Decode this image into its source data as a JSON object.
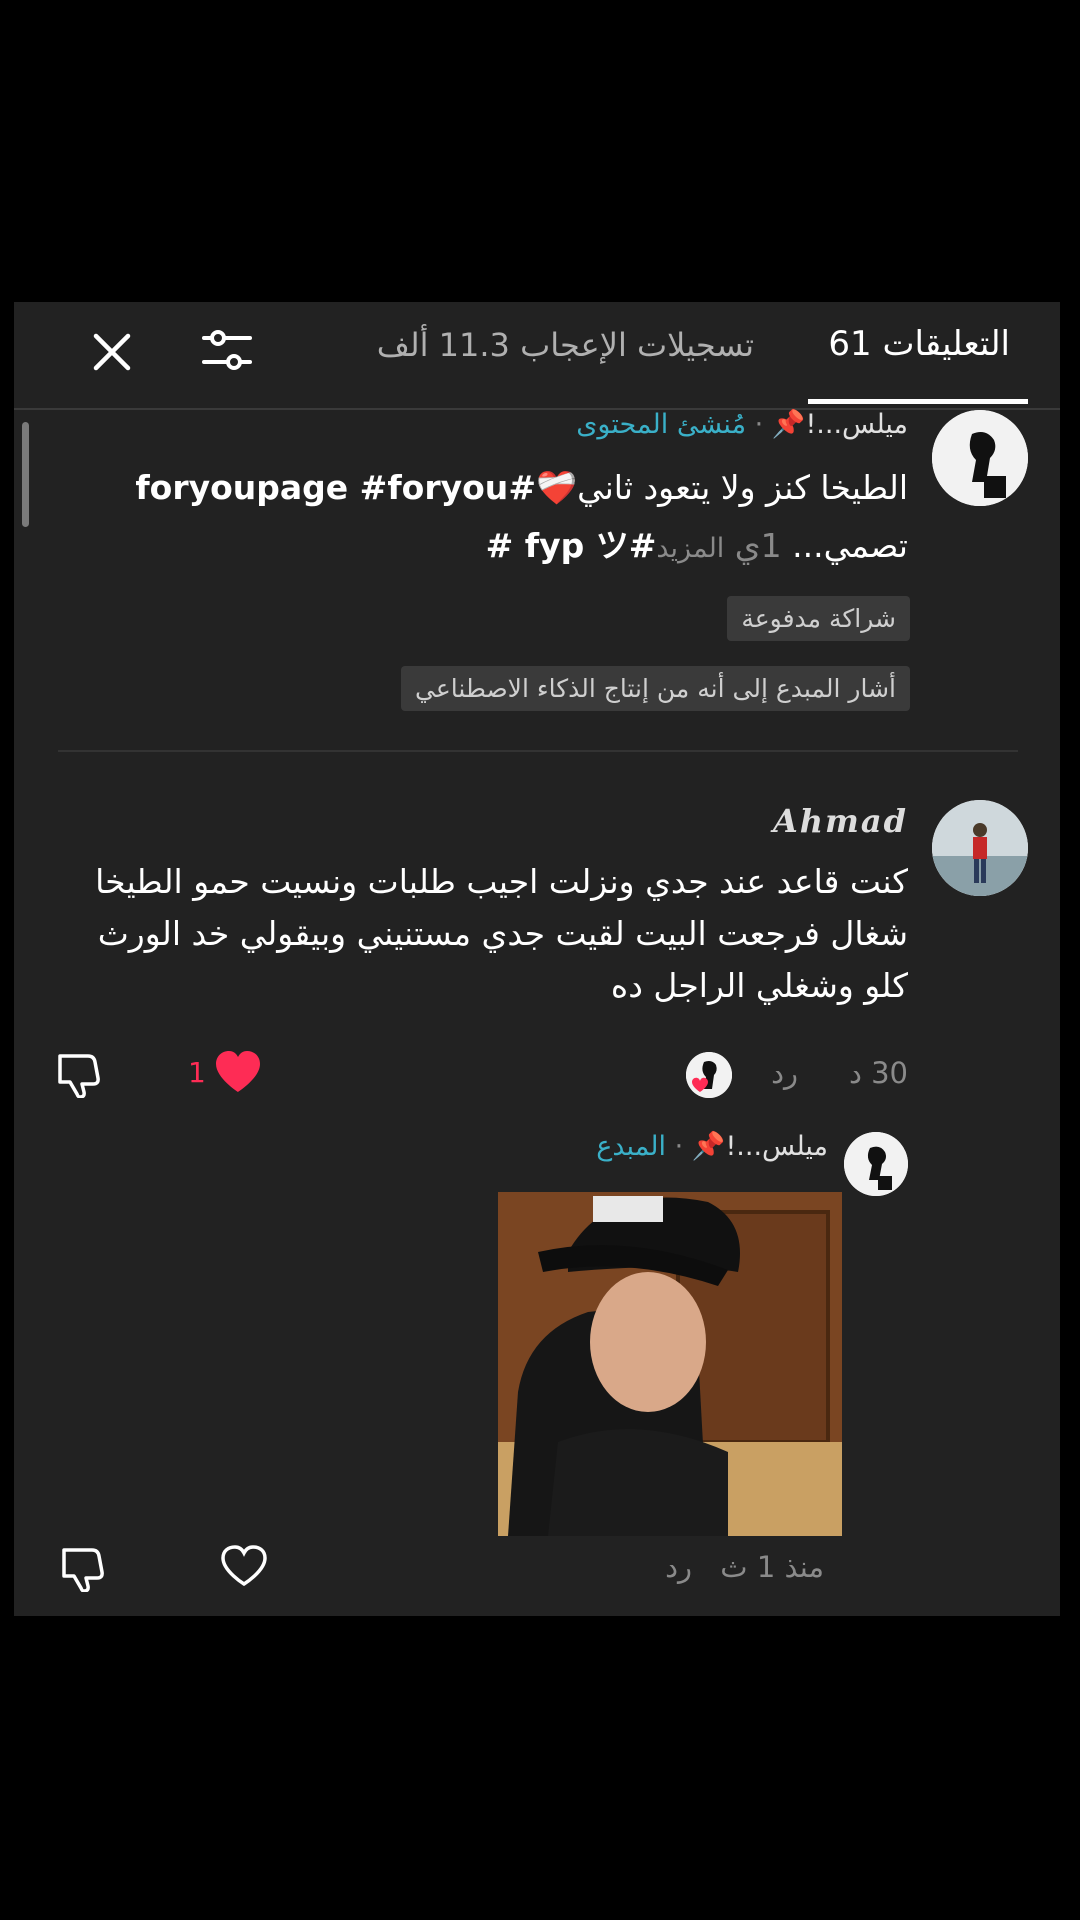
{
  "header": {
    "comments_tab": "التعليقات 61",
    "likes_tab": "تسجيلات الإعجاب 11.3 ألف"
  },
  "pinned_post": {
    "author": "ميلس...!",
    "pin": "📌",
    "separator": "·",
    "role": "مُنشئ المحتوى",
    "line1": "الطيخا كنز ولا يتعود ثاني",
    "heart": "❤️‍🩹",
    "hashtags1": "#foryoupage #foryou",
    "line2_start": "تصمي...",
    "line2_more": "المزيد",
    "line2_mid": "1ي",
    "hashtags2": "#fyp ツ #",
    "tag_paid": "شراكة مدفوعة",
    "tag_ai": "أشار المبدع إلى أنه من إنتاج الذكاء الاصطناعي"
  },
  "comment": {
    "author": "Ahmad",
    "text": "كنت قاعد عند جدي ونزلت اجيب طلبات ونسيت حمو الطيخا شغال فرجعت البيت لقيت جدي مستنيني وبيقولي خد الورث كلو وشغلي الراجل ده",
    "time": "30 د",
    "reply_label": "رد",
    "likes": "1"
  },
  "reply": {
    "author": "ميلس...!",
    "pin": "📌",
    "separator": "·",
    "role": "المبدع",
    "time": "منذ 1 ث",
    "reply_label": "رد"
  },
  "colors": {
    "accent_red": "#fe2c55",
    "teal": "#3ab0c8",
    "panel_bg": "#222222"
  }
}
